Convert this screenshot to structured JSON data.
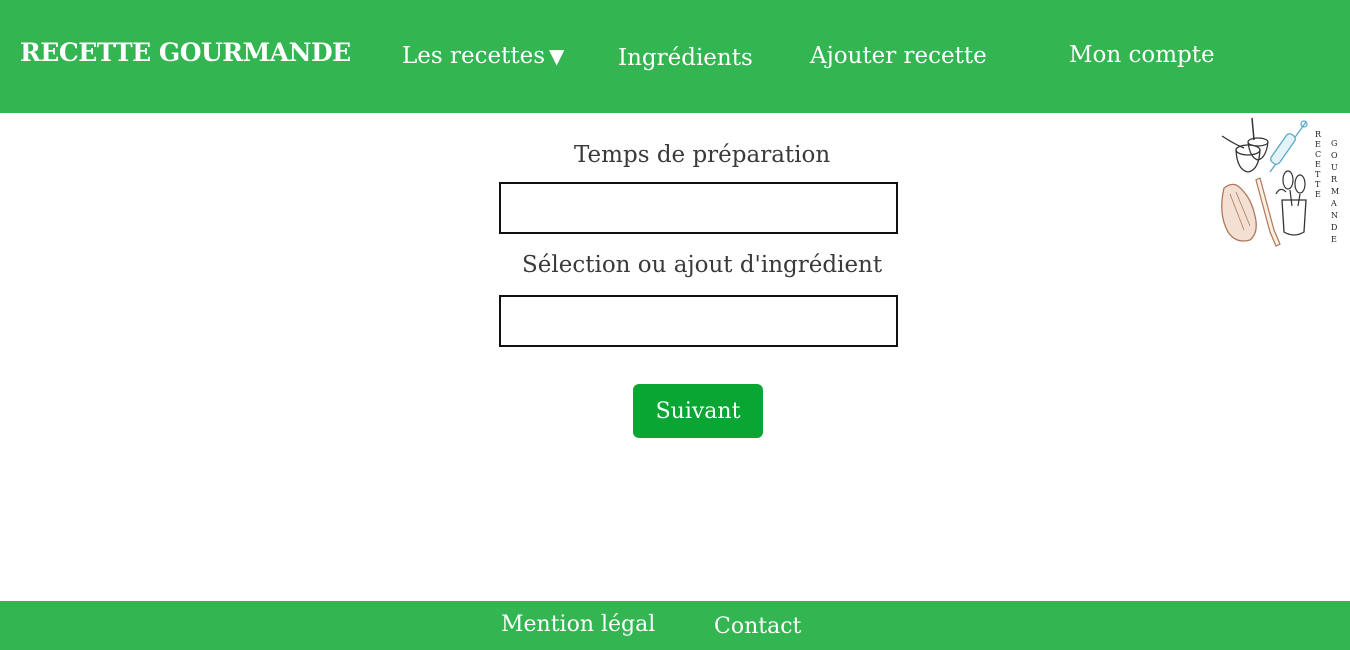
{
  "header": {
    "brand": "RECETTE GOURMANDE",
    "nav": {
      "recettes": "Les recettes",
      "recettes_caret": "▼",
      "ingredients": "Ingrédients",
      "ajouter": "Ajouter recette",
      "compte": "Mon compte"
    }
  },
  "logo": {
    "icon": "kitchen-utensils-logo",
    "text_line1": "RECETTE",
    "text_line2": "GOURMANDE"
  },
  "form": {
    "temps_label": "Temps de préparation",
    "temps_value": "",
    "ingredient_label": "Sélection ou ajout d'ingrédient",
    "ingredient_value": "",
    "submit_label": "Suivant"
  },
  "footer": {
    "mention": "Mention légal",
    "contact": "Contact"
  },
  "colors": {
    "header_bg": "#33b551",
    "button_bg": "#0aa634",
    "text": "#333333"
  }
}
